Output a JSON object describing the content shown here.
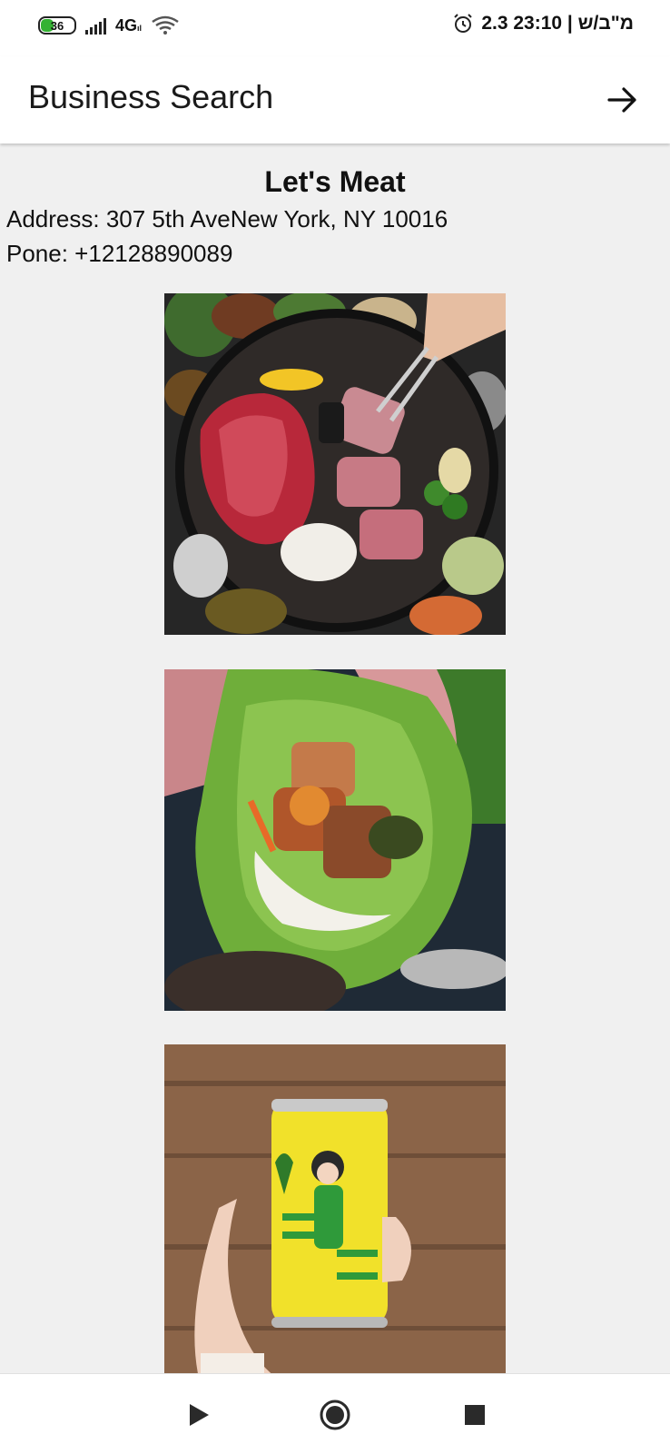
{
  "status_bar": {
    "battery_level": "36",
    "network": "4G",
    "network_suffix": "ıl",
    "right_text": "2.3 מ\"ב/ש | 23:10"
  },
  "app_bar": {
    "title": "Business Search",
    "action_icon": "arrow-right-icon"
  },
  "business": {
    "name": "Let's Meat",
    "address": "Address: 307 5th AveNew York, NY 10016",
    "phone": "Pone: +12128890089"
  },
  "photos": [
    {
      "name": "korean-bbq-grill-photo"
    },
    {
      "name": "lettuce-wrap-photo"
    },
    {
      "name": "pineapple-soju-can-photo"
    }
  ],
  "nav_bar": {
    "icons": [
      "back-triangle-icon",
      "home-circle-icon",
      "recents-square-icon"
    ]
  },
  "colors": {
    "background": "#f0f0f0",
    "app_bar": "#ffffff",
    "battery_fill": "#34b233"
  }
}
